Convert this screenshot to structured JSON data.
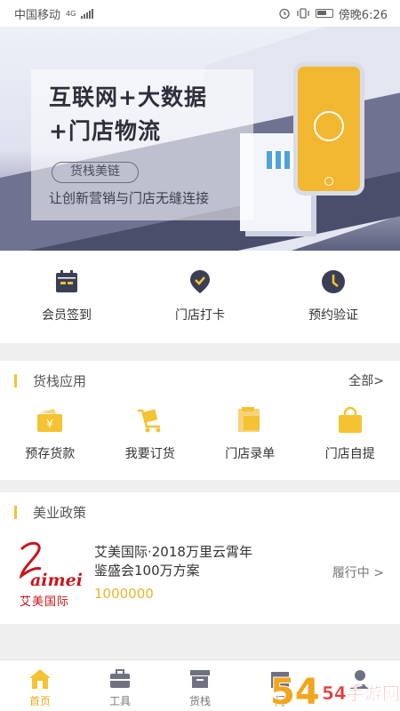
{
  "status_bar": {
    "carrier": "中国移动",
    "network": "4G",
    "time": "傍晚6:26"
  },
  "banner": {
    "headline_line1": "互联网+大数据",
    "headline_line2": "+门店物流",
    "brand_pill": "货栈美链",
    "tagline": "让创新营销与门店无缝连接"
  },
  "quick_actions": [
    {
      "label": "会员签到",
      "icon": "calendar-icon"
    },
    {
      "label": "门店打卡",
      "icon": "location-check-icon"
    },
    {
      "label": "预约验证",
      "icon": "clock-icon"
    }
  ],
  "apps_section": {
    "title": "货栈应用",
    "more": "全部>",
    "items": [
      {
        "label": "预存货款",
        "icon": "wallet-yuan-icon"
      },
      {
        "label": "我要订货",
        "icon": "cart-box-icon"
      },
      {
        "label": "门店录单",
        "icon": "clipboard-box-icon"
      },
      {
        "label": "门店自提",
        "icon": "shopping-bag-icon"
      }
    ]
  },
  "policy_section": {
    "title": "美业政策",
    "items": [
      {
        "brand_logo_text": "aimei",
        "brand_logo_cn": "艾美国际",
        "name": "艾美国际·2018万里云霄年鉴盛会100万方案",
        "price": "1000000",
        "status": "履行中 >"
      }
    ]
  },
  "tab_bar": [
    {
      "label": "首页",
      "icon": "home-icon",
      "active": true
    },
    {
      "label": "工具",
      "icon": "briefcase-icon",
      "active": false
    },
    {
      "label": "货栈",
      "icon": "warehouse-icon",
      "active": false
    },
    {
      "label": "门",
      "icon": "store-icon",
      "active": false
    },
    {
      "label": "",
      "icon": "user-icon",
      "active": false
    }
  ],
  "watermark": "54手游网",
  "colors": {
    "accent": "#f4c232",
    "active_tab": "#e3ac1f",
    "icon_dark": "#3b3f55"
  }
}
